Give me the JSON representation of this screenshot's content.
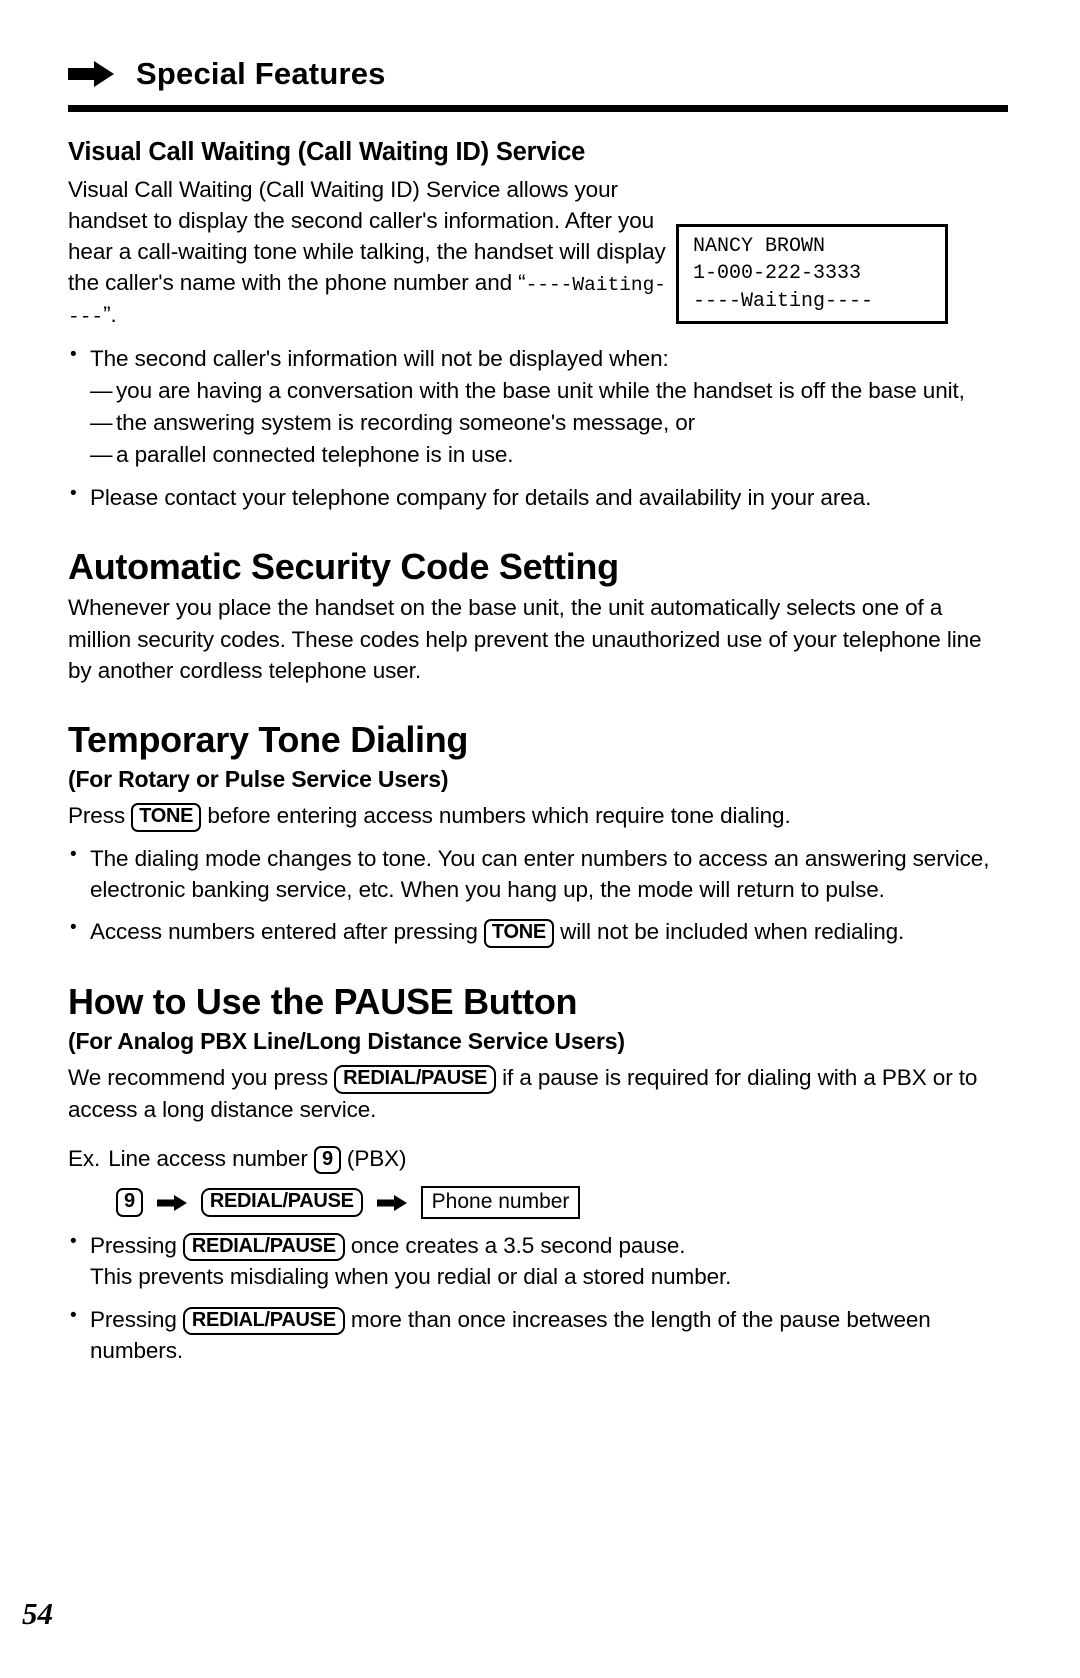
{
  "header": {
    "icon": "right-arrow-icon",
    "title": "Special Features"
  },
  "sections": {
    "visual_call_waiting": {
      "heading": "Visual Call Waiting (Call Waiting ID) Service",
      "intro_part1": "Visual Call Waiting (Call Waiting ID) Service allows your handset to display the second caller's information. After you hear a call-waiting tone while talking, the handset will display the caller's name with the phone number and “",
      "intro_mono": "----Waiting----",
      "intro_part2": "”.",
      "lcd": {
        "line1": "NANCY BROWN",
        "line2": "1-000-222-3333",
        "line3": "----Waiting----"
      },
      "bullet1": "The second caller's information will not be displayed when:",
      "sub_bullets": [
        "you are having a conversation with the base unit while the handset is off the base unit,",
        "the answering system is recording someone's message, or",
        "a parallel connected telephone is in use."
      ],
      "bullet2": "Please contact your telephone company for details and availability in your area."
    },
    "automatic_security": {
      "heading": "Automatic Security Code Setting",
      "body": "Whenever you place the handset on the base unit, the unit automatically selects one of a million security codes. These codes help prevent the unauthorized use of your telephone line by another cordless telephone user."
    },
    "temporary_tone": {
      "heading": "Temporary Tone Dialing",
      "subheading": "(For Rotary or Pulse Service Users)",
      "instruction_pre": "Press",
      "tone_key": "TONE",
      "instruction_post": "before entering access numbers which require tone dialing.",
      "bullet1": "The dialing mode changes to tone. You can enter numbers to access an answering service, electronic banking service, etc. When you hang up, the mode will return to pulse.",
      "bullet2_pre": "Access numbers entered after pressing",
      "bullet2_post": "will not be included when redialing."
    },
    "pause_button": {
      "heading": "How to Use the PAUSE Button",
      "subheading": "(For Analog PBX Line/Long Distance Service Users)",
      "recommend_pre": "We recommend you press",
      "redial_pause_key": "REDIAL/PAUSE",
      "recommend_post": "if a pause is required for dialing with a PBX or to access a long distance service.",
      "example_label": "Ex.",
      "example_pre": "Line access number",
      "nine_key": "9",
      "example_post": "(PBX)",
      "flow": {
        "step1": "9",
        "step2": "REDIAL/PAUSE",
        "step3": "Phone number",
        "arrow_icon": "right-arrow-icon"
      },
      "bullet1_pre": "Pressing",
      "bullet1_post": "once creates a 3.5 second pause.",
      "bullet1_line2": "This prevents misdialing when you redial or dial a stored number.",
      "bullet2_pre": "Pressing",
      "bullet2_post": "more than once increases the length of the pause between numbers."
    }
  },
  "page_number": "54"
}
